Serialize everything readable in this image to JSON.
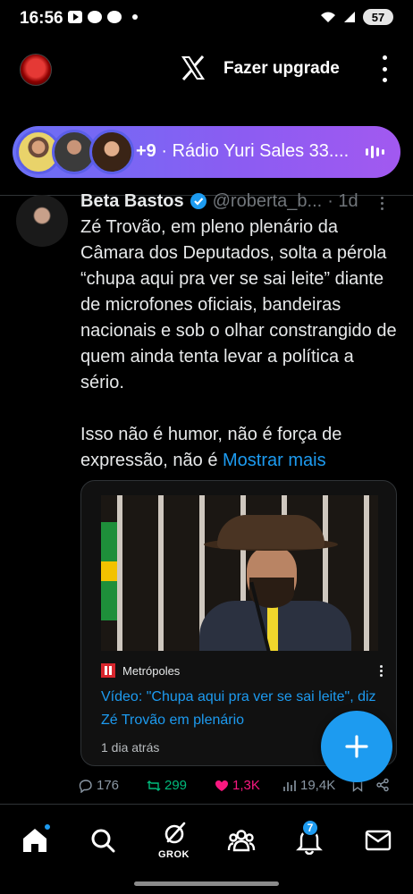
{
  "status_bar": {
    "time": "16:56",
    "battery": "57"
  },
  "header": {
    "upgrade_label": "Fazer upgrade",
    "logo_icon": "x-logo-icon"
  },
  "spaces": {
    "count": "+9",
    "label": "· Rádio Yuri Sales 33....",
    "gradient_start": "#6a6ff5",
    "gradient_end": "#a259f0"
  },
  "tweet": {
    "author": "Beta Bastos",
    "handle": "@roberta_b...",
    "time": "· 1d",
    "paragraph1": "Zé Trovão, em pleno plenário da Câmara dos Deputados, solta a pérola “chupa aqui pra ver se sai leite” diante de microfones oficiais, bandeiras nacionais e sob o olhar constrangido de quem ainda tenta levar a política a sério.",
    "paragraph2": "Isso não é humor, não é força de expressão, não é",
    "show_more": "Mostrar mais",
    "card": {
      "source": "Metrópoles",
      "title": "Vídeo: \"Chupa aqui pra ver se sai leite\", diz Zé Trovão em plenário",
      "date": "1 dia atrás"
    },
    "actions": {
      "replies": "176",
      "retweets": "299",
      "likes": "1,3K",
      "views": "19,4K"
    }
  },
  "nav": {
    "grok_label": "GROK",
    "notifications_badge": "7"
  },
  "colors": {
    "accent": "#1d9bf0",
    "retweet": "#00ba7c",
    "like": "#f91880",
    "muted": "#71767b"
  }
}
